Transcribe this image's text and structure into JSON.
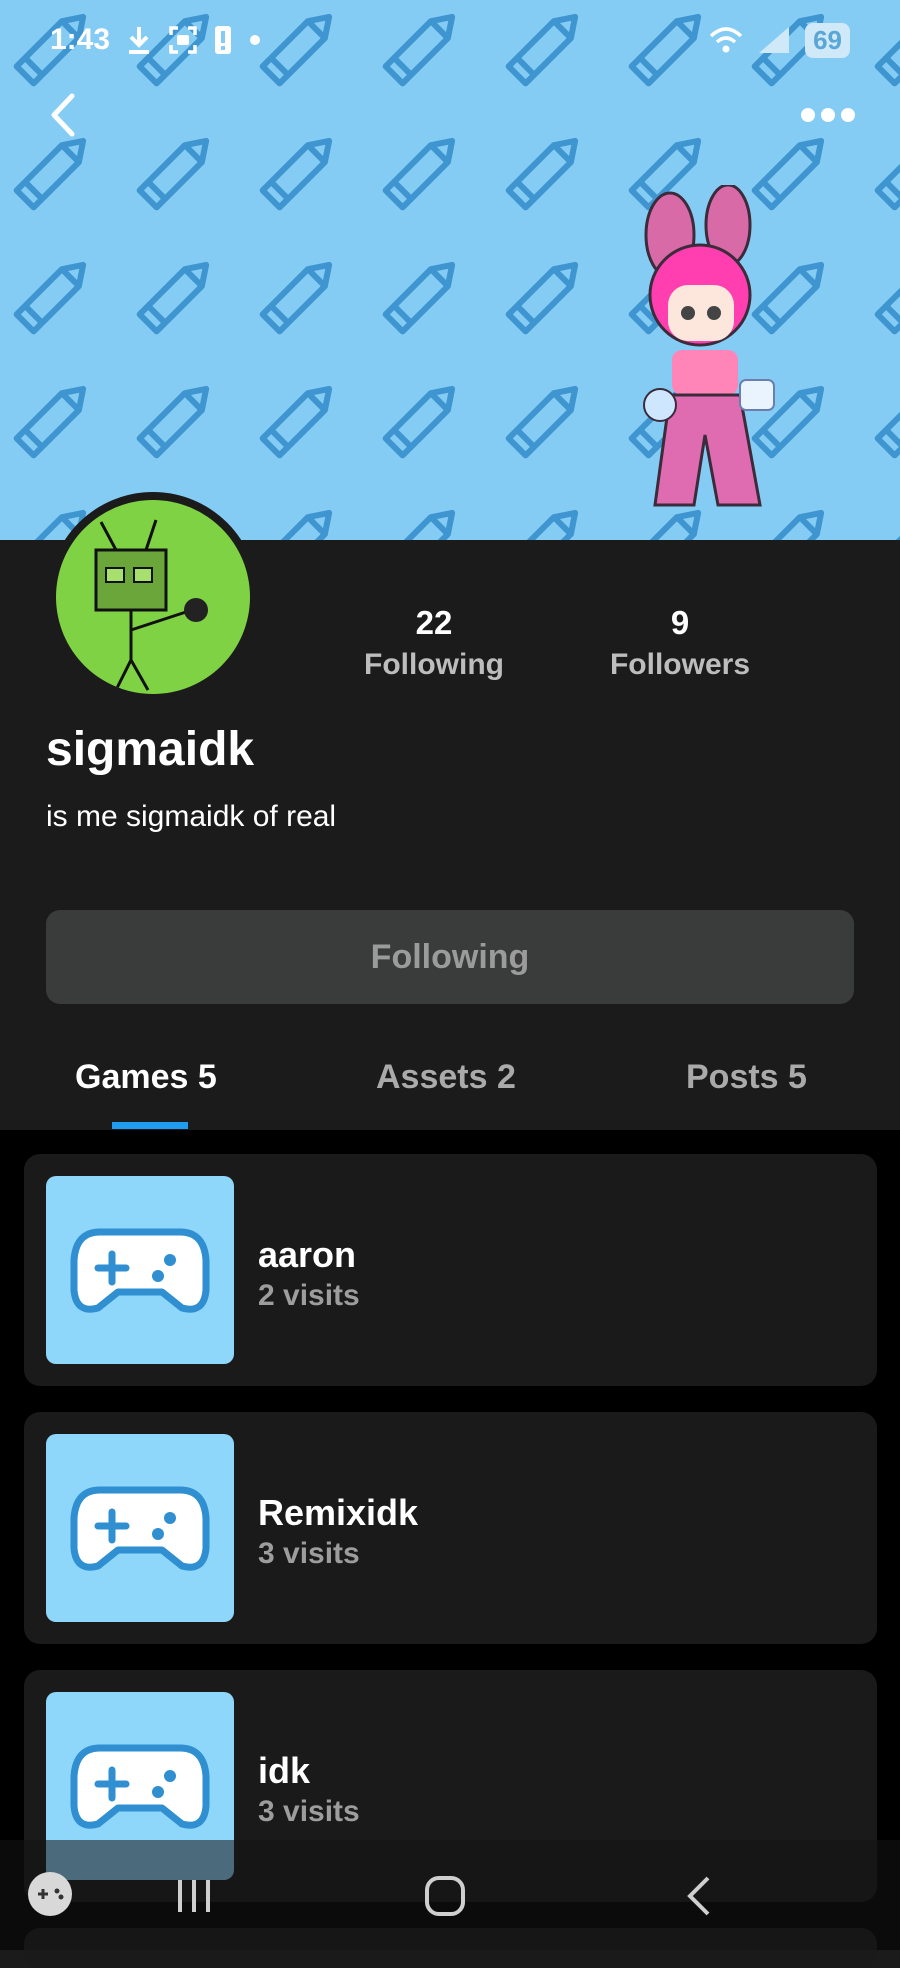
{
  "status_bar": {
    "time": "1:43",
    "battery": "69"
  },
  "profile": {
    "username": "sigmaidk",
    "bio": "is me sigmaidk of real",
    "following_count": "22",
    "following_label": "Following",
    "followers_count": "9",
    "followers_label": "Followers",
    "follow_button_label": "Following"
  },
  "tabs": [
    {
      "label": "Games 5",
      "active": true
    },
    {
      "label": "Assets 2",
      "active": false
    },
    {
      "label": "Posts 5",
      "active": false
    }
  ],
  "games": [
    {
      "title": "aaron",
      "visits": "2 visits"
    },
    {
      "title": "Remixidk",
      "visits": "3 visits"
    },
    {
      "title": "idk",
      "visits": "3 visits"
    }
  ],
  "colors": {
    "banner": "#84ccf4",
    "accent": "#1f9bf0",
    "thumb": "#8fd6fb"
  }
}
